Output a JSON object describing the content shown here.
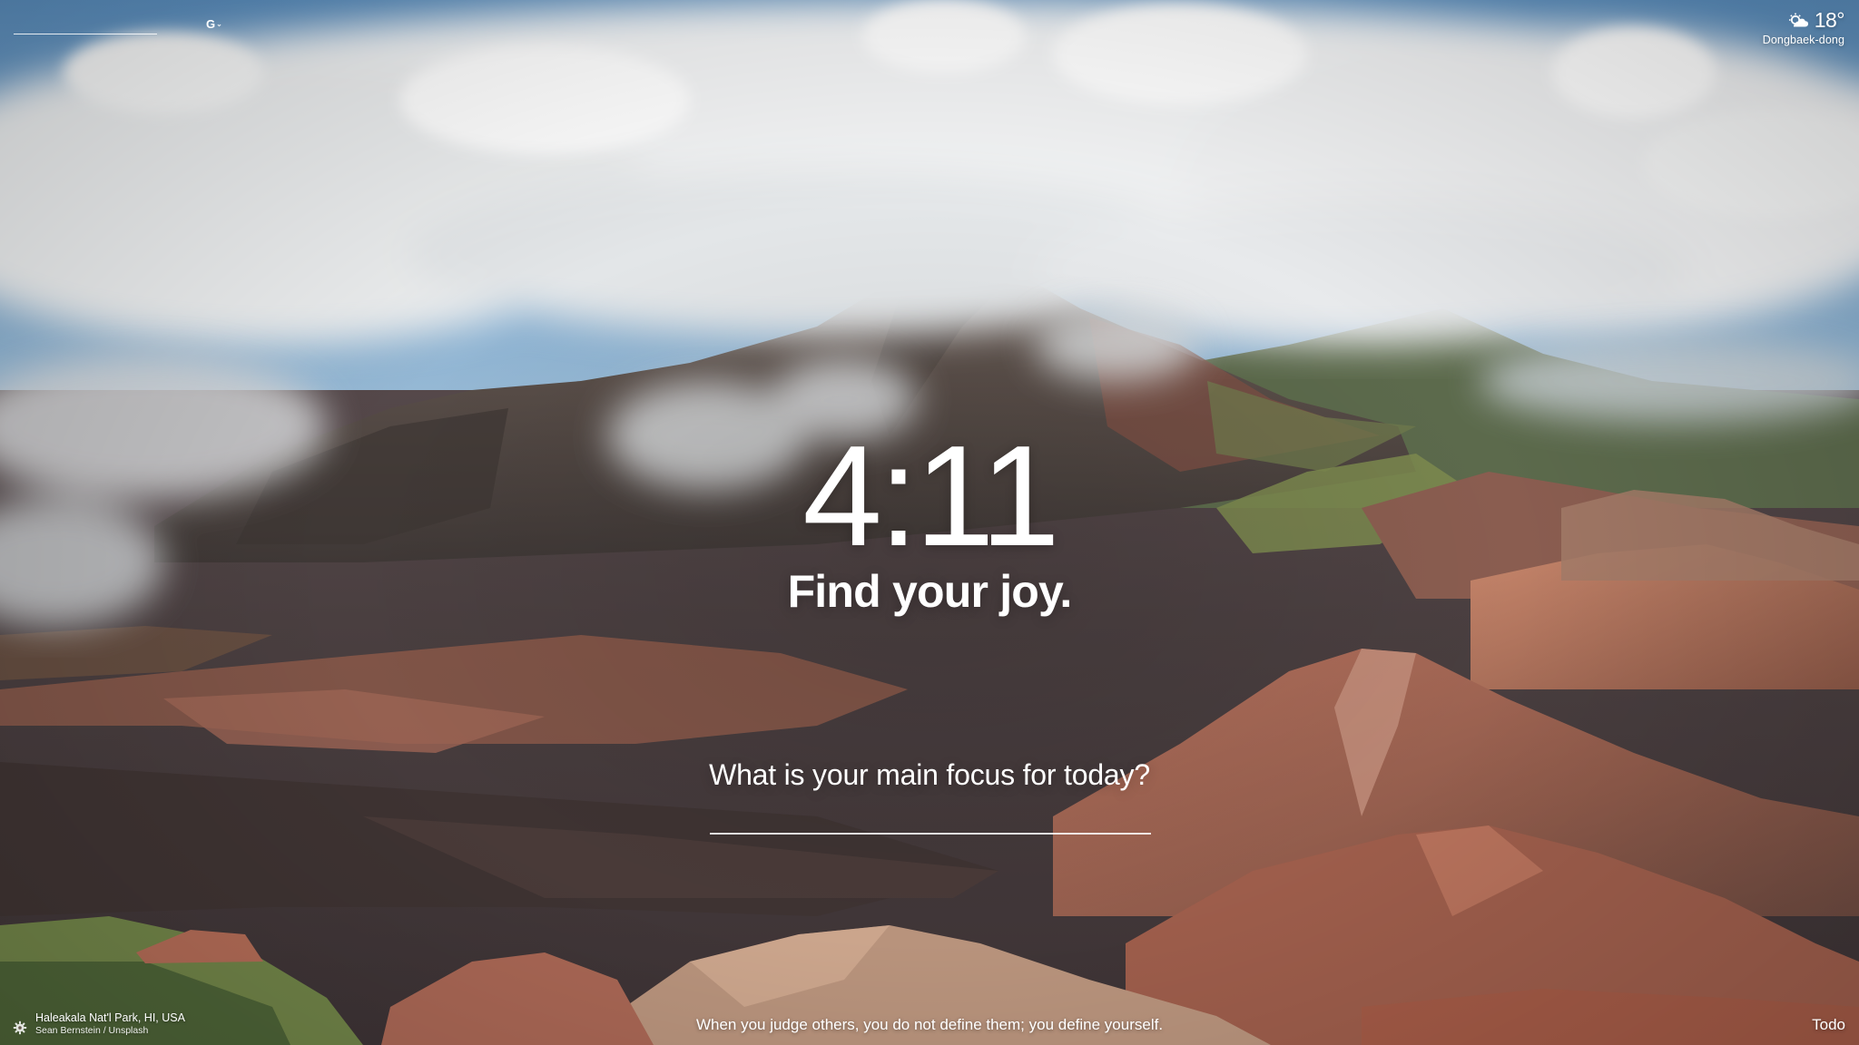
{
  "search": {
    "placeholder": "",
    "engine_label": "G",
    "engine_chevron": "⌄"
  },
  "weather": {
    "temperature": "18°",
    "location": "Dongbaek-dong",
    "icon": "partly-cloudy-icon"
  },
  "clock": {
    "time": "4:11"
  },
  "greeting": {
    "text": "Find your joy."
  },
  "focus": {
    "question": "What is your main focus for today?",
    "value": ""
  },
  "photo": {
    "title": "Haleakala Nat'l Park, HI, USA",
    "credit": "Sean Bernstein / Unsplash"
  },
  "quote": {
    "text": "When you judge others, you do not define them; you define yourself."
  },
  "todo": {
    "label": "Todo"
  },
  "settings": {
    "icon": "gear-icon"
  },
  "colors": {
    "text": "#ffffff",
    "sky": "#6e9cc6",
    "cloud": "#eef0f1",
    "rock": "#5a4e49",
    "red_cinder": "#a8614c"
  }
}
